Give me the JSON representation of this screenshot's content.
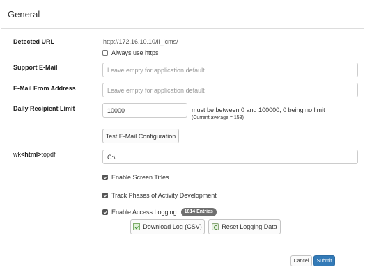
{
  "panel": {
    "title": "General"
  },
  "detected_url": {
    "label": "Detected URL",
    "value": "http://172.16.10.10/ll_lcms/",
    "always_https_label": "Always use https",
    "always_https_checked": false
  },
  "support_email": {
    "label": "Support E-Mail",
    "value": "",
    "placeholder": "Leave empty for application default"
  },
  "email_from": {
    "label": "E-Mail From Address",
    "value": "",
    "placeholder": "Leave empty for application default"
  },
  "daily_limit": {
    "label": "Daily Recipient Limit",
    "value": "10000",
    "hint": "must be between 0 and 100000, 0 being no limit",
    "current_average": "(Current average = 158)"
  },
  "test_email_button": "Test E-Mail Configuration",
  "wkhtmltopdf": {
    "label_prefix": "wk",
    "label_middle": "<html>",
    "label_suffix": "topdf",
    "value": "C:\\"
  },
  "options": {
    "screen_titles": {
      "label": "Enable Screen Titles",
      "checked": true
    },
    "track_phases": {
      "label": "Track Phases of Activity Development",
      "checked": true
    },
    "access_logging": {
      "label": "Enable Access Logging",
      "checked": true,
      "badge": "1814 Entries"
    }
  },
  "log_buttons": {
    "download": "Download Log (CSV)",
    "reset": "Reset Logging Data"
  },
  "footer": {
    "cancel": "Cancel",
    "submit": "Submit"
  },
  "colors": {
    "primary": "#337ab7",
    "badge": "#6f6f6f"
  }
}
